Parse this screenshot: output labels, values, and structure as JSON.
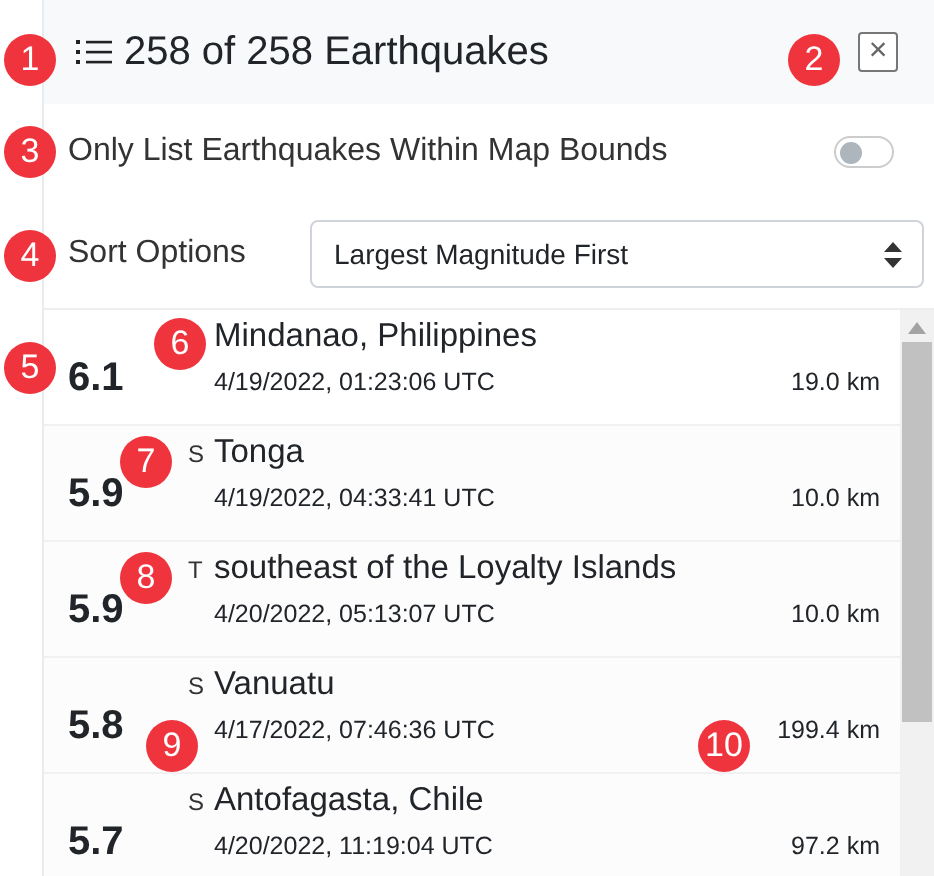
{
  "header": {
    "title": "258 of 258 Earthquakes",
    "close": "×"
  },
  "filter": {
    "label": "Only List Earthquakes Within Map Bounds",
    "on": false
  },
  "sort": {
    "label": "Sort Options",
    "value": "Largest Magnitude First"
  },
  "quakes": [
    {
      "magnitude": "6.1",
      "place": "Mindanao, Philippines",
      "time": "4/19/2022, 01:23:06 UTC",
      "depth": "19.0 km"
    },
    {
      "magnitude": "5.9",
      "prefix": "S",
      "place": "Tonga",
      "time": "4/19/2022, 04:33:41 UTC",
      "depth": "10.0 km"
    },
    {
      "magnitude": "5.9",
      "prefix": "T",
      "place": "southeast of the Loyalty Islands",
      "time": "4/20/2022, 05:13:07 UTC",
      "depth": "10.0 km"
    },
    {
      "magnitude": "5.8",
      "prefix": "S",
      "place": "Vanuatu",
      "time": "4/17/2022, 07:46:36 UTC",
      "depth": "199.4 km"
    },
    {
      "magnitude": "5.7",
      "prefix": "S",
      "place": "Antofagasta, Chile",
      "time": "4/20/2022, 11:19:04 UTC",
      "depth": "97.2 km"
    }
  ],
  "callouts": [
    "1",
    "2",
    "3",
    "4",
    "5",
    "6",
    "7",
    "8",
    "9",
    "10"
  ]
}
